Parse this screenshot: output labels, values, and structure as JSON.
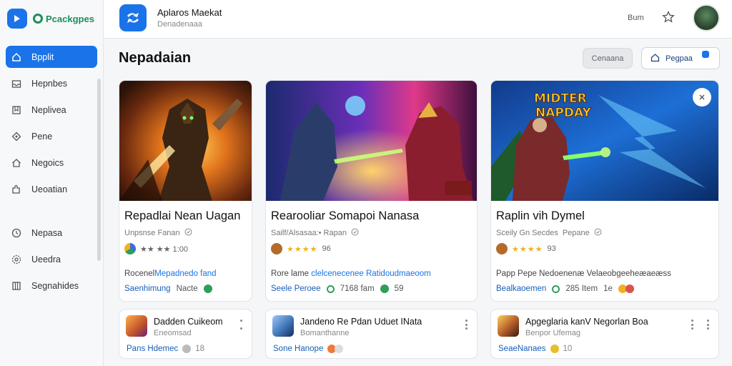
{
  "sidebar": {
    "brand": "Pcackgpes",
    "items": [
      {
        "label": "Bpplit",
        "icon": "home-icon",
        "active": true
      },
      {
        "label": "Hepnbes",
        "icon": "inbox-icon"
      },
      {
        "label": "Neplivea",
        "icon": "bookmark-icon"
      },
      {
        "label": "Pene",
        "icon": "diamond-icon"
      },
      {
        "label": "Negoics",
        "icon": "house-icon"
      },
      {
        "label": "Ueoatian",
        "icon": "puzzle-icon"
      },
      {
        "label": "Nepasa",
        "icon": "clock-icon"
      },
      {
        "label": "Ueedra",
        "icon": "settings-icon"
      },
      {
        "label": "Segnahides",
        "icon": "columns-icon"
      }
    ]
  },
  "topbar": {
    "app_title": "Aplaros Maekat",
    "app_subtitle": "Denadenaaa",
    "link": "Bum"
  },
  "main": {
    "title": "Nepadaian",
    "cancel_label": "Cenaana",
    "primary_label": "Pegpaa"
  },
  "cards": [
    {
      "title": "Repadlai Nean Uagan",
      "subtitle": "Unpsnse Fanan",
      "rating_text": "★★ ★★ 1:00",
      "desc_prefix": "Rocenel",
      "desc_accent": "Mepadnedo fand",
      "foot_accent": "Saenhimung",
      "foot_text": "Nacte",
      "colors": {
        "dot": "#3b6fd8",
        "chip": "#2f9e5a"
      }
    },
    {
      "title": "Rearooliar Somapoi Nanasa",
      "subtitle": "Sailf/Alsasaa:• Rapan",
      "stars": "★★★★",
      "rating_num": "96",
      "desc_prefix": "Rore lame",
      "desc_accent": "clelcenecenee Ratidoudmaeoom",
      "foot_accent": "Seele Peroee",
      "foot_text": "7168 fam",
      "foot_num": "59",
      "colors": {
        "dot": "#b46b2a",
        "chip": "#2f9e5a"
      }
    },
    {
      "title": "Raplin vih Dymel",
      "subtitle": "Sceily Gn Secdes",
      "subtitle_b": "Pepane",
      "stars": "★★★★",
      "rating_num": "93",
      "desc_prefix": "Papp Pepe",
      "desc_accent": "Nedoenenæ Velaeobgeeheæaeæss",
      "foot_accent": "Bealkaoemen",
      "foot_text": "285 Item",
      "foot_num": "1e",
      "overlay_text": [
        "MIDTER",
        "NAPDAY"
      ],
      "colors": {
        "dot": "#b46b2a",
        "chip": "#d9534f"
      }
    }
  ],
  "minis": [
    {
      "title": "Dadden Cuikeom",
      "subtitle": "Eneomsad",
      "foot_accent": "Pans Hdemec",
      "foot_num": "18",
      "colors": {
        "thumb": "#c0522b"
      }
    },
    {
      "title": "Jandeno Re Pdan Uduet INata",
      "subtitle": "Bomanthanne",
      "foot_accent": "Sone Hanope",
      "colors": {
        "thumb": "#3a6fb0"
      }
    },
    {
      "title": "Apgeglaria kanV Negorlan Boa",
      "subtitle": "Benpor Ufemag",
      "foot_accent": "SeaeNanaes",
      "foot_num": "10",
      "colors": {
        "thumb": "#b05a2a"
      }
    }
  ],
  "colors": {
    "accent": "#1a73e8",
    "brand_green": "#1e8e5a",
    "star": "#f2b01e"
  }
}
